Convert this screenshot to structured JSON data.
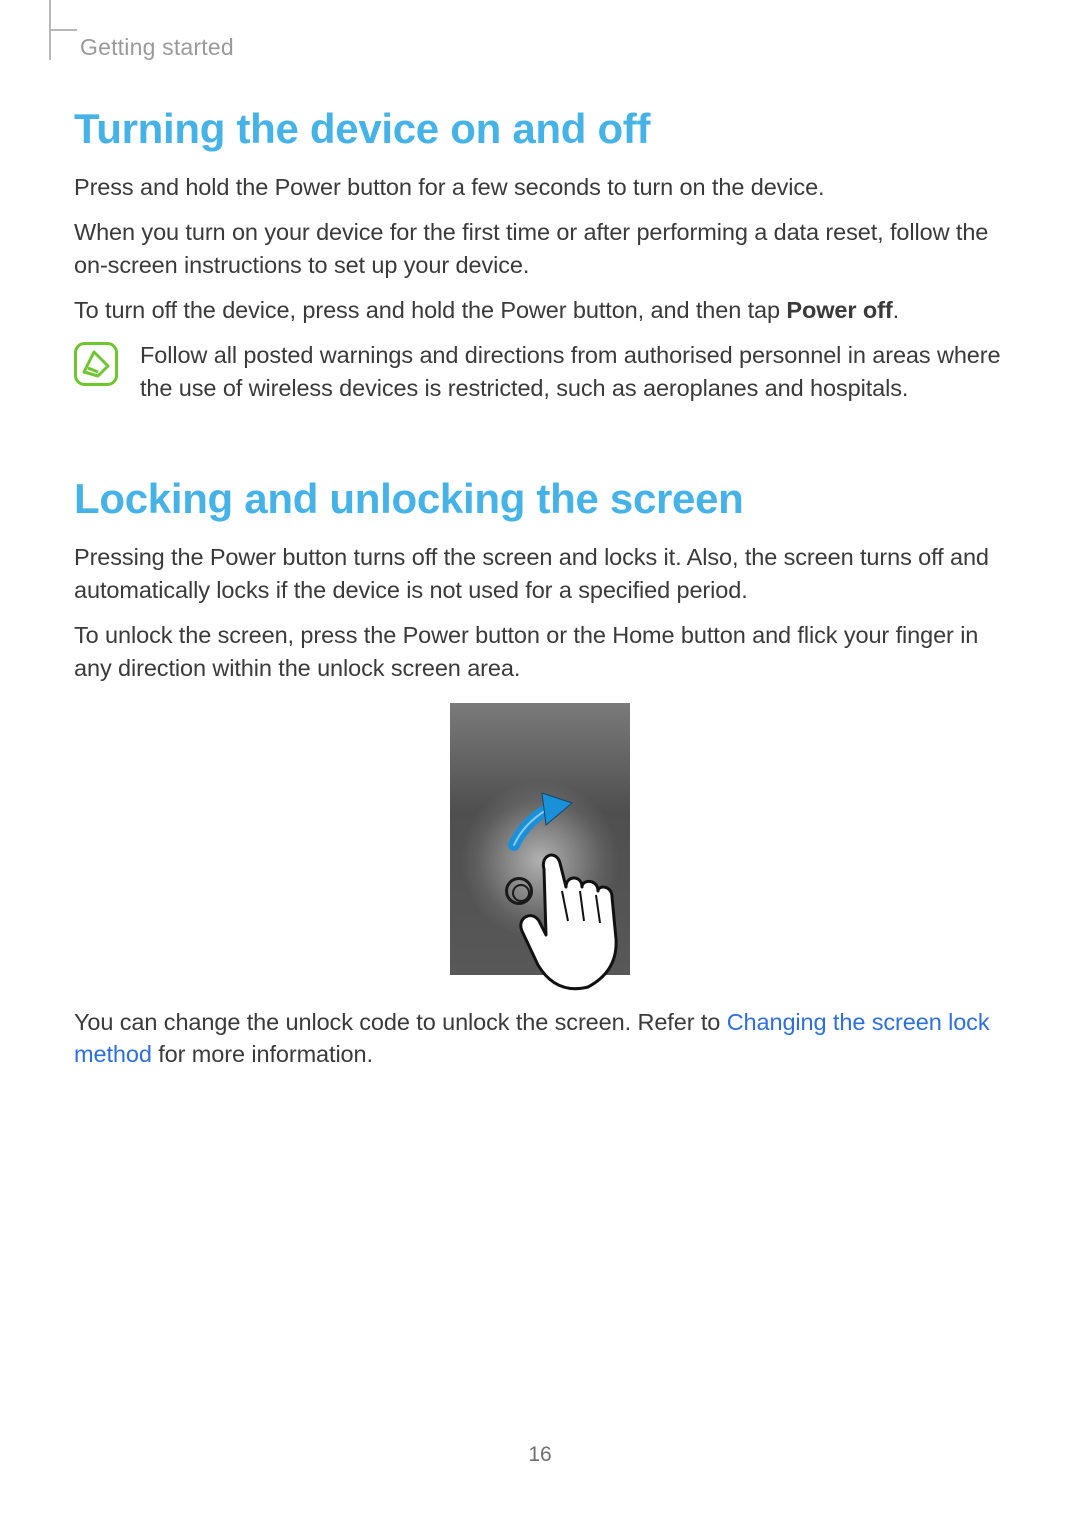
{
  "chapter": "Getting started",
  "section1": {
    "heading": "Turning the device on and off",
    "p1": "Press and hold the Power button for a few seconds to turn on the device.",
    "p2": "When you turn on your device for the first time or after performing a data reset, follow the on-screen instructions to set up your device.",
    "p3_pre": "To turn off the device, press and hold the Power button, and then tap ",
    "p3_bold": "Power off",
    "p3_post": ".",
    "note": "Follow all posted warnings and directions from authorised personnel in areas where the use of wireless devices is restricted, such as aeroplanes and hospitals."
  },
  "section2": {
    "heading": "Locking and unlocking the screen",
    "p1": "Pressing the Power button turns off the screen and locks it. Also, the screen turns off and automatically locks if the device is not used for a specified period.",
    "p2": "To unlock the screen, press the Power button or the Home button and flick your finger in any direction within the unlock screen area.",
    "p3_pre": "You can change the unlock code to unlock the screen. Refer to ",
    "p3_link": "Changing the screen lock method",
    "p3_post": " for more information."
  },
  "page_number": "16"
}
